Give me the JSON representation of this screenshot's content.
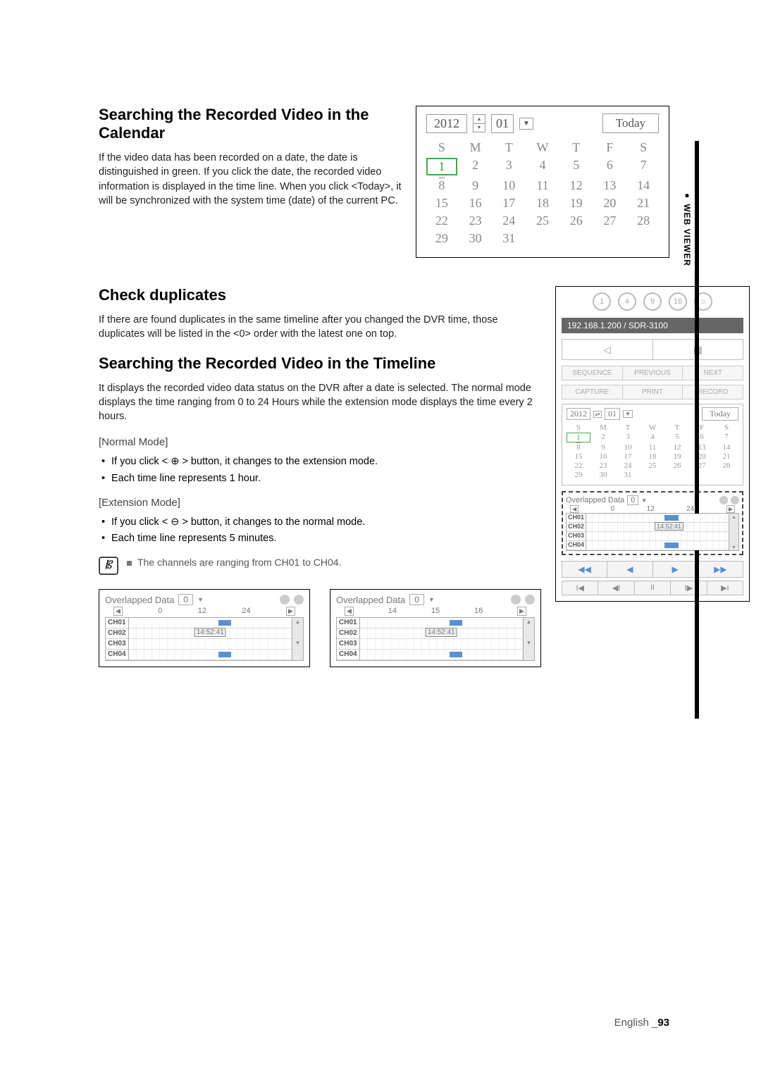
{
  "sideTab": "WEB VIEWER",
  "sections": {
    "calendar": {
      "heading": "Searching the Recorded Video in the Calendar",
      "body": "If the video data has been recorded on a date, the date is distinguished in green. If you click the date, the recorded video information is displayed in the time line. When you click <Today>, it will be synchronized with the system time (date) of the current PC."
    },
    "duplicates": {
      "heading": "Check duplicates",
      "body": "If there are found duplicates in the same timeline after you changed the DVR time, those duplicates will be listed in the <0> order with the latest one on top."
    },
    "timeline": {
      "heading": "Searching the Recorded Video in the Timeline",
      "body": "It displays the recorded video data status on the DVR after a date is selected. The normal mode displays the time ranging from 0 to 24 Hours while the extension mode displays the time every 2 hours.",
      "normalLabel": "[Normal Mode]",
      "normalBullets": [
        "If you click < ⊕ > button, it changes to the extension mode.",
        "Each time line represents 1 hour."
      ],
      "extLabel": "[Extension Mode]",
      "extBullets": [
        "If you click < ⊖ > button, it changes to the normal mode.",
        "Each time line represents 5 minutes."
      ],
      "note": "The channels are ranging from CH01 to CH04."
    }
  },
  "largeCalendar": {
    "year": "2012",
    "month": "01",
    "todayLabel": "Today",
    "dows": [
      "S",
      "M",
      "T",
      "W",
      "T",
      "F",
      "S"
    ],
    "days": [
      [
        "1",
        "2",
        "3",
        "4",
        "5",
        "6",
        "7"
      ],
      [
        "8",
        "9",
        "10",
        "11",
        "12",
        "13",
        "14"
      ],
      [
        "15",
        "16",
        "17",
        "18",
        "19",
        "20",
        "21"
      ],
      [
        "22",
        "23",
        "24",
        "25",
        "26",
        "27",
        "28"
      ],
      [
        "29",
        "30",
        "31",
        "",
        "",
        "",
        ""
      ]
    ],
    "highlightDay": "1",
    "strikeDay": "8"
  },
  "overlap": {
    "title": "Overlapped Data",
    "selector": "0",
    "cursor": "14:52:41",
    "channels": [
      "CH01",
      "CH02",
      "CH03",
      "CH04"
    ],
    "normalRuler": [
      "0",
      "12",
      "24"
    ],
    "extRuler": [
      "14",
      "15",
      "16"
    ]
  },
  "searchPanel": {
    "layouts": [
      "1",
      "4",
      "9",
      "16",
      "☼"
    ],
    "address": "192.168.1.200  /  SDR-3100",
    "splitIcons": [
      "◁",
      "▦"
    ],
    "row1": [
      "SEQUENCE",
      "PREVIOUS",
      "NEXT"
    ],
    "row2": [
      "CAPTURE",
      "PRINT",
      "RECORD"
    ],
    "cal": {
      "year": "2012",
      "month": "01",
      "today": "Today",
      "dows": [
        "S",
        "M",
        "T",
        "W",
        "T",
        "F",
        "S"
      ]
    },
    "playIcons": [
      "◀◀",
      "◀",
      "▶",
      "▶▶"
    ],
    "stepIcons": [
      "I◀",
      "◀I",
      "II",
      "I▶",
      "▶I"
    ]
  },
  "footer": {
    "lang": "English",
    "page": "93"
  }
}
